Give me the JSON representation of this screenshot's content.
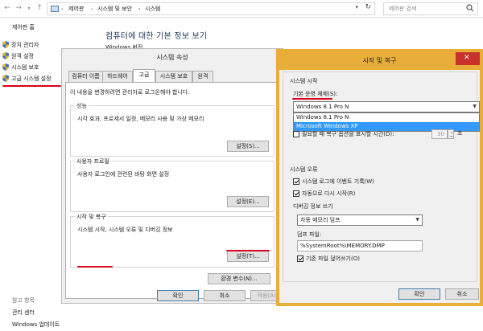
{
  "address": {
    "crumbs": [
      "제어판",
      "시스템 및 보안",
      "시스템"
    ],
    "search_placeholder": "제어판 검색"
  },
  "left_panel": {
    "home": "제어판 홈",
    "items": [
      "장치 관리자",
      "원격 설정",
      "시스템 보호",
      "고급 시스템 설정"
    ],
    "see_also": {
      "title": "참고 항목",
      "links": [
        "관리 센터",
        "Windows 업데이트"
      ]
    }
  },
  "main": {
    "title": "컴퓨터에 대한 기본 정보 보기",
    "windows_edition": "Windows 버전"
  },
  "system_properties": {
    "title": "시스템 속성",
    "tabs": [
      "컴퓨터 이름",
      "하드웨어",
      "고급",
      "시스템 보호",
      "원격"
    ],
    "active_tab": "고급",
    "note": "이 내용을 변경하려면 관리자로 로그온해야 합니다.",
    "groups": [
      {
        "title": "성능",
        "desc": "시각 효과, 프로세서 일정, 메모리 사용 및 가상 메모리",
        "button": "설정(S)..."
      },
      {
        "title": "사용자 프로필",
        "desc": "사용자 로그인에 관련된 바탕 화면 설정",
        "button": "설정(E)..."
      },
      {
        "title": "시작 및 복구",
        "desc": "시스템 시작, 시스템 오류 및 디버깅 정보",
        "button": "설정(T)..."
      }
    ],
    "env_button": "환경 변수(N)...",
    "ok": "확인",
    "cancel": "취소",
    "apply": "적용(A)"
  },
  "startup_recovery": {
    "title": "시작 및 복구",
    "system_startup": "시스템 시작",
    "default_os_label": "기본 운영 체제(S):",
    "default_os_value": "Windows 8.1 Pro N",
    "os_options": [
      "Windows 8.1 Pro N",
      "Microsoft Windows XP"
    ],
    "os_selected_index": 1,
    "show_recovery_label": "필요할 때 복구 옵션을 표시할 시간(D):",
    "show_recovery_checked": false,
    "recovery_seconds": "30",
    "seconds_unit": "초",
    "system_failure": "시스템 오류",
    "write_event": "시스템 로그에 이벤트 기록(W)",
    "write_event_checked": true,
    "auto_restart": "자동으로 다시 시작(R)",
    "auto_restart_checked": true,
    "debug_info": "디버깅 정보 쓰기",
    "debug_type": "자동 메모리 덤프",
    "dump_file_label": "덤프 파일:",
    "dump_file": "%SystemRoot%\\MEMORY.DMP",
    "overwrite": "기존 파일 덮어쓰기(O)",
    "overwrite_checked": true,
    "ok": "확인",
    "cancel": "취소"
  },
  "colors": {
    "highlight_red": "#d8001c",
    "dialog_border_orange": "#e9ad3a",
    "selection_blue": "#3399ff",
    "close_red": "#c7302b"
  }
}
